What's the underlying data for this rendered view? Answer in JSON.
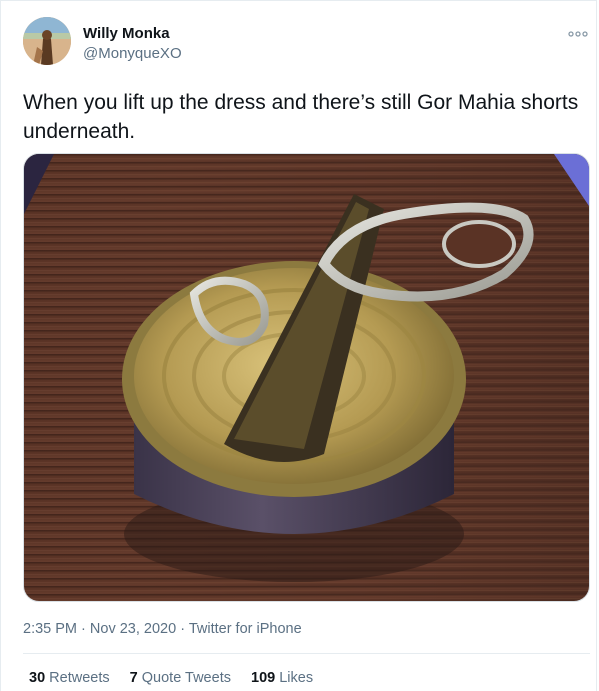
{
  "tweet": {
    "author_name": "Willy Monka",
    "author_handle": "@MonyqueXO",
    "text": "When you lift up the dress and there’s still Gor Mahia shorts underneath.",
    "image_icon": "photo-image",
    "time": "2:35 PM",
    "date": "Nov 23, 2020",
    "source": "Twitter for iPhone",
    "separator": "·"
  },
  "stats": {
    "retweets_count": "30",
    "retweets_label": "Retweets",
    "quotes_count": "7",
    "quotes_label": "Quote Tweets",
    "likes_count": "109",
    "likes_label": "Likes"
  },
  "colors": {
    "primary_text": "#0f1419",
    "secondary_text": "#5b7083",
    "border": "#e6ecf0"
  }
}
